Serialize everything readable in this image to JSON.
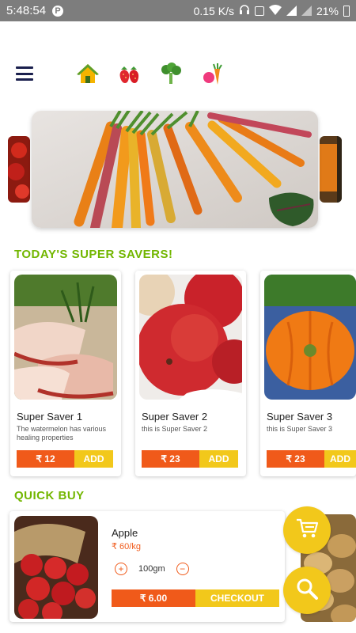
{
  "status_bar": {
    "time": "5:48:54",
    "speed": "0.15 K/s",
    "battery": "21%"
  },
  "nav": {
    "icons": [
      "menu-icon",
      "home-icon",
      "fruits-icon",
      "vegetables-icon",
      "combo-icon"
    ]
  },
  "sections": {
    "super_savers_title": "TODAY'S SUPER SAVERS!",
    "quick_buy_title": "QUICK BUY"
  },
  "super_savers": [
    {
      "name": "Super Saver 1",
      "desc": "The watermelon has various healing properties",
      "price": "₹ 12",
      "add": "ADD"
    },
    {
      "name": "Super Saver 2",
      "desc": "this is Super Saver 2",
      "price": "₹ 23",
      "add": "ADD"
    },
    {
      "name": "Super Saver 3",
      "desc": "this is Super Saver 3",
      "price": "₹ 23",
      "add": "ADD"
    }
  ],
  "quick_buy": {
    "name": "Apple",
    "price": "₹ 60/kg",
    "minus": "−",
    "plus": "+",
    "qty": "100gm",
    "total": "₹ 6.00",
    "checkout": "CHECKOUT"
  },
  "colors": {
    "accent_green": "#72b600",
    "orange": "#f05a1a",
    "yellow": "#f2c81b"
  }
}
